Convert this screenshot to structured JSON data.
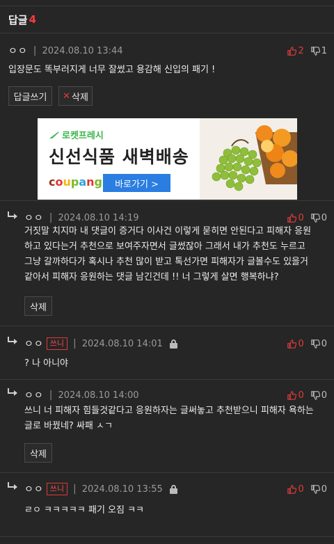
{
  "header": {
    "title": "답글",
    "count": "4"
  },
  "comments": [
    {
      "nick": "ㅇㅇ",
      "date": "2024.08.10 13:44",
      "up": "2",
      "down": "1",
      "text": "입장문도 똑부러지게 너무 잘썼고 용감해 신입의 패기 !",
      "buttons": {
        "reply": "답글쓰기",
        "delete": "삭제"
      }
    },
    {
      "nick": "ㅇㅇ",
      "date": "2024.08.10 14:19",
      "up": "0",
      "down": "0",
      "lines": [
        "거짓말 치지마 내 댓글이 증거다 이사건 이렇게 묻히면 안된다고 피해자 응원",
        "하고 있다는거 추천으로 보여주자면서 글썼잖아 그래서 내가 추천도 누르고",
        "그냥 갈까하다가 혹시나 추천 많이 받고 톡선가면 피해자가 글볼수도 있을거",
        "같아서 피해자 응원하는 댓글 남긴건데 !! 너 그렇게 살면 행복하냐?"
      ],
      "buttons": {
        "delete": "삭제"
      }
    },
    {
      "nick": "ㅇㅇ",
      "badge": "쓰니",
      "date": "2024.08.10 14:01",
      "up": "0",
      "down": "0",
      "text": "? 나 아니야"
    },
    {
      "nick": "ㅇㅇ",
      "date": "2024.08.10 14:00",
      "up": "0",
      "down": "0",
      "lines": [
        "쓰니 너 피해자 힘들것같다고 응원하자는 글써놓고 추천받으니 피해자 욕하는",
        "글로 바꿨네? 싸패 ㅅㄱ"
      ],
      "buttons": {
        "delete": "삭제"
      }
    },
    {
      "nick": "ㅇㅇ",
      "badge": "쓰니",
      "date": "2024.08.10 13:55",
      "up": "0",
      "down": "0",
      "text": "ㄹㅇ ㅋㅋㅋㅋㅋ 패기 오짐 ㅋㅋ"
    }
  ],
  "ad": {
    "brand": "로켓프레시",
    "title": "신선식품 새벽배송",
    "coupang": "coupang",
    "cta": "바로가기 >"
  },
  "colors": {
    "bg": "#262626",
    "accent": "#e23b3b",
    "link": "#2a7de1"
  }
}
